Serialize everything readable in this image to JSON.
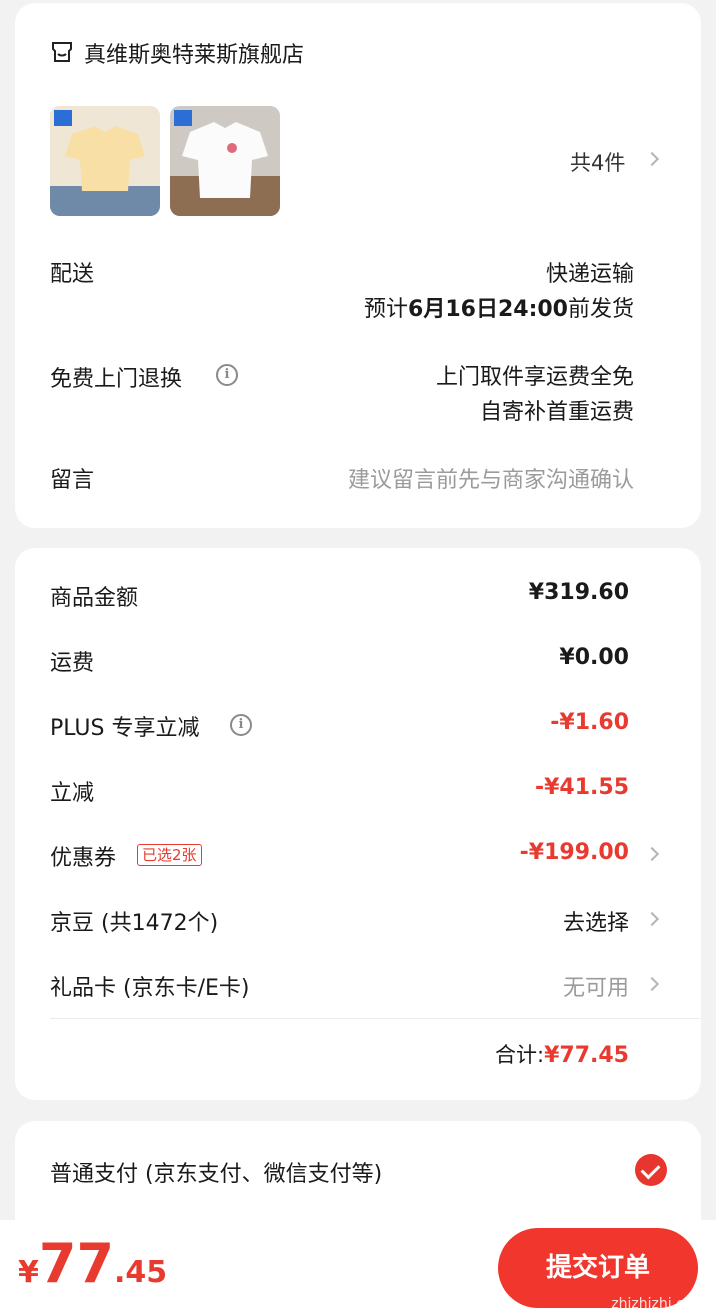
{
  "store": {
    "name": "真维斯奥特莱斯旗舰店",
    "item_count_label": "共4件"
  },
  "delivery": {
    "label": "配送",
    "method": "快递运输",
    "eta_prefix": "预计",
    "eta_bold": "6月16日24:00",
    "eta_suffix": "前发货"
  },
  "returns": {
    "label": "免费上门退换",
    "line1": "上门取件享运费全免",
    "line2": "自寄补首重运费"
  },
  "message": {
    "label": "留言",
    "placeholder": "建议留言前先与商家沟通确认"
  },
  "price": {
    "goods_label": "商品金额",
    "goods_value": "¥319.60",
    "shipping_label": "运费",
    "shipping_value": "¥0.00",
    "plus_label": "PLUS 专享立减",
    "plus_value": "-¥1.60",
    "discount_label": "立减",
    "discount_value": "-¥41.55",
    "coupon_label": "优惠券",
    "coupon_badge": "已选2张",
    "coupon_value": "-¥199.00",
    "beans_label": "京豆 (共1472个)",
    "beans_value": "去选择",
    "giftcard_label": "礼品卡 (京东卡/E卡)",
    "giftcard_value": "无可用",
    "total_label": "合计:",
    "total_value": "¥77.45"
  },
  "payment": {
    "method_label": "普通支付 (京东支付、微信支付等)"
  },
  "bottom": {
    "currency": "¥",
    "amount_int": "77",
    "amount_dec": ".45",
    "submit_label": "提交订单",
    "watermark": "zhizhizhi.com"
  },
  "colors": {
    "accent": "#e83a2f",
    "button": "#f0362d",
    "background": "#f2f2f2"
  }
}
